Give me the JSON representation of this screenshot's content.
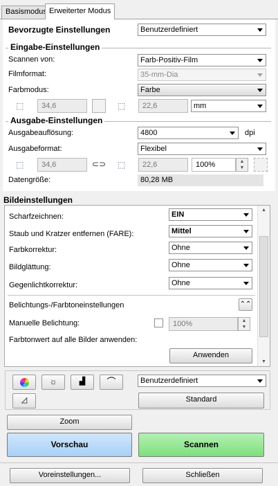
{
  "tabs": {
    "basic": "Basismodus",
    "advanced": "Erweiterter Modus"
  },
  "preferred": {
    "label": "Bevorzugte Einstellungen",
    "value": "Benutzerdefiniert"
  },
  "input": {
    "title": "Eingabe-Einstellungen",
    "scan_from_label": "Scannen von:",
    "scan_from_value": "Farb-Positiv-Film",
    "film_format_label": "Filmformat:",
    "film_format_value": "35-mm-Dia",
    "color_mode_label": "Farbmodus:",
    "color_mode_value": "Farbe",
    "width": "34,6",
    "height": "22,6",
    "unit": "mm"
  },
  "output": {
    "title": "Ausgabe-Einstellungen",
    "resolution_label": "Ausgabeauflösung:",
    "resolution_value": "4800",
    "resolution_unit": "dpi",
    "format_label": "Ausgabeformat:",
    "format_value": "Flexibel",
    "width": "34,6",
    "height": "22,6",
    "scale": "100%",
    "datasize_label": "Datengröße:",
    "datasize_value": "80,28 MB"
  },
  "image": {
    "title": "Bildeinstellungen",
    "sharpen_label": "Scharfzeichnen:",
    "sharpen_value": "EIN",
    "fare_label": "Staub und Kratzer entfernen (FARE):",
    "fare_value": "Mittel",
    "color_corr_label": "Farbkorrektur:",
    "color_corr_value": "Ohne",
    "smoothing_label": "Bildglättung:",
    "smoothing_value": "Ohne",
    "backlight_label": "Gegenlichtkorrektur:",
    "backlight_value": "Ohne",
    "exposure_section": "Belichtungs-/Farbtoneinstellungen",
    "manual_exposure_label": "Manuelle Belichtung:",
    "manual_exposure_value": "100%",
    "apply_all_label": "Farbtonwert auf alle Bilder anwenden:",
    "apply_button": "Anwenden"
  },
  "tools": {
    "preset_value": "Benutzerdefiniert",
    "standard_button": "Standard"
  },
  "actions": {
    "zoom": "Zoom",
    "preview": "Vorschau",
    "scan": "Scannen",
    "presets": "Voreinstellungen...",
    "close": "Schließen"
  },
  "colors": {
    "preview_bg": "#a8d0f7",
    "scan_bg": "#7de07d"
  }
}
